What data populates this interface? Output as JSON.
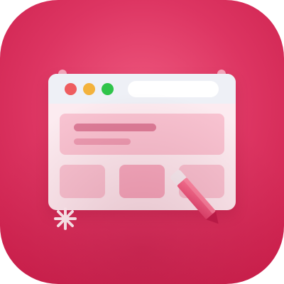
{
  "icon": {
    "name": "web-editor-app-icon",
    "kind": "application icon",
    "colors": {
      "background_light": "#ef5a80",
      "background_mid": "#dd3562",
      "background_dark": "#c81c48",
      "window_body": "#fcebf0",
      "titlebar": "#eef0f6",
      "window_red": "#ee5c5f",
      "window_yellow": "#f3b23c",
      "window_green": "#2fc44a",
      "pencil_body": "#e95b7f",
      "pencil_dark": "#bf1d4a",
      "pencil_cap": "#f6f1f4"
    },
    "icons": [
      "browser-window-icon",
      "pencil-icon",
      "sparkle-icon"
    ]
  }
}
